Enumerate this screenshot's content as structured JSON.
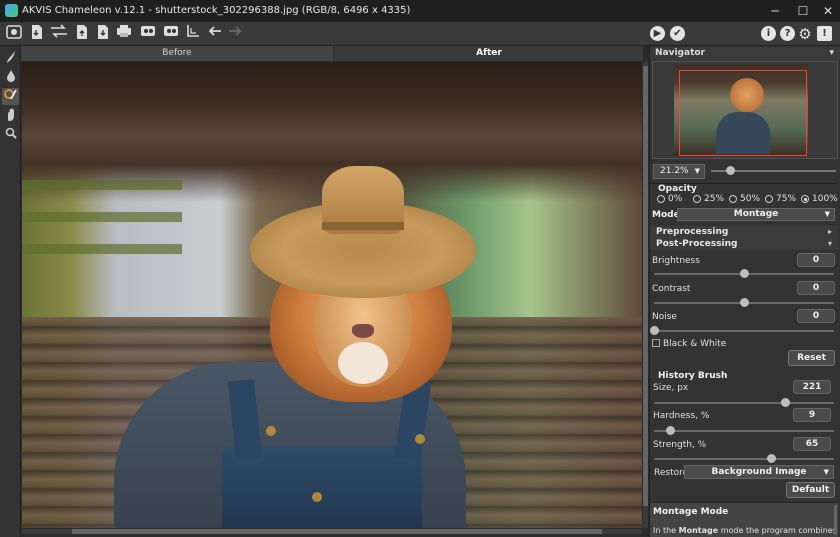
{
  "window": {
    "title": "AKVIS Chameleon v.12.1 - shutterstock_302296388.jpg (RGB/8, 6496 x 4335)",
    "minimize": "─",
    "maximize": "☐",
    "close": "✕",
    "menu": "⋮"
  },
  "toolbar": {
    "run_icon": "▶",
    "apply_icon": "✔",
    "about_icon": "i",
    "help_icon": "?",
    "prefs_icon": "⚙",
    "notify_icon": "!"
  },
  "tabs": {
    "before": "Before",
    "after": "After"
  },
  "navigator": {
    "title": "Navigator",
    "collapse": "▾",
    "zoom": "21.2%",
    "zoom_slider": 0.15
  },
  "opacity": {
    "label": "Opacity",
    "options": [
      "0%",
      "25%",
      "50%",
      "75%",
      "100%"
    ],
    "selected": "100%"
  },
  "mode": {
    "label": "Mode",
    "value": "Montage"
  },
  "preprocessing": {
    "label": "Preprocessing",
    "chevron": "▸"
  },
  "postprocessing": {
    "label": "Post-Processing",
    "chevron": "▾",
    "brightness": {
      "label": "Brightness",
      "value": "0",
      "slider": 0.5
    },
    "contrast": {
      "label": "Contrast",
      "value": "0",
      "slider": 0.5
    },
    "noise": {
      "label": "Noise",
      "value": "0",
      "slider": 0.0
    },
    "black_white": "Black & White",
    "reset": "Reset"
  },
  "history_brush": {
    "title": "History Brush",
    "size": {
      "label": "Size, px",
      "value": "221",
      "slider": 0.73
    },
    "hardness": {
      "label": "Hardness, %",
      "value": "9",
      "slider": 0.09
    },
    "strength": {
      "label": "Strength, %",
      "value": "65",
      "slider": 0.65
    },
    "restore_label": "Restore",
    "restore_value": "Background Image",
    "default": "Default"
  },
  "help": {
    "title": "Montage Mode",
    "text_prefix": "In the",
    "text_bold": "Montage",
    "text_suffix": "mode the program combines"
  },
  "colors": {
    "background": "#2b2b2b",
    "panel": "#333333",
    "accent_red": "#ff3b3b"
  }
}
